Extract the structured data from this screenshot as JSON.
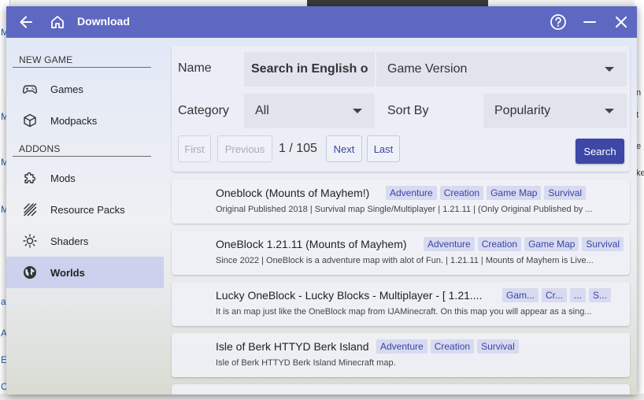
{
  "window": {
    "title": "Download"
  },
  "background": {
    "left_glyphs": [
      "M",
      "M",
      "M",
      "M",
      "a",
      "A",
      "E",
      "C"
    ],
    "right_glyphs": [
      "n",
      "t",
      "e",
      "ke"
    ]
  },
  "sidebar": {
    "sections": [
      {
        "header": "NEW GAME",
        "items": [
          {
            "label": "Games",
            "icon": "gamepad-icon"
          },
          {
            "label": "Modpacks",
            "icon": "cube-icon"
          }
        ]
      },
      {
        "header": "ADDONS",
        "items": [
          {
            "label": "Mods",
            "icon": "puzzle-icon"
          },
          {
            "label": "Resource Packs",
            "icon": "texture-icon"
          },
          {
            "label": "Shaders",
            "icon": "sun-icon"
          },
          {
            "label": "Worlds",
            "icon": "globe-icon",
            "active": true
          }
        ]
      }
    ]
  },
  "filters": {
    "name_label": "Name",
    "name_value": "Search in English o",
    "game_version_value": "Game Version",
    "category_label": "Category",
    "category_value": "All",
    "sort_label": "Sort By",
    "sort_value": "Popularity"
  },
  "pagination": {
    "first": "First",
    "previous": "Previous",
    "page_text": "1 / 105",
    "next": "Next",
    "last": "Last",
    "search": "Search"
  },
  "results": [
    {
      "title": "Oneblock (Mounts of Mayhem!)",
      "tags": [
        "Adventure",
        "Creation",
        "Game Map",
        "Survival"
      ],
      "description": "Original Published 2018 | Survival map Single/Multiplayer | 1.21.11 | (Only Original Published by ..."
    },
    {
      "title": "OneBlock 1.21.11 (Mounts of Mayhem)",
      "tags": [
        "Adventure",
        "Creation",
        "Game Map",
        "Survival"
      ],
      "description": "Since 2022 | OneBlock is a adventure map with alot of Fun. | 1.21.11 | Mounts of Mayhem is Live..."
    },
    {
      "title": "Lucky OneBlock - Lucky Blocks - Multiplayer -  [ 1.21....",
      "tags": [
        "Gam...",
        "Cr...",
        "...",
        "S..."
      ],
      "description": "It is an map just like the OneBlock map from IJAMinecraft. On this map you will appear as a sing..."
    },
    {
      "title": "Isle of Berk HTTYD Berk Island",
      "tags": [
        "Adventure",
        "Creation",
        "Survival"
      ],
      "description": "Isle of Berk HTTYD Berk Island Minecraft map."
    }
  ]
}
